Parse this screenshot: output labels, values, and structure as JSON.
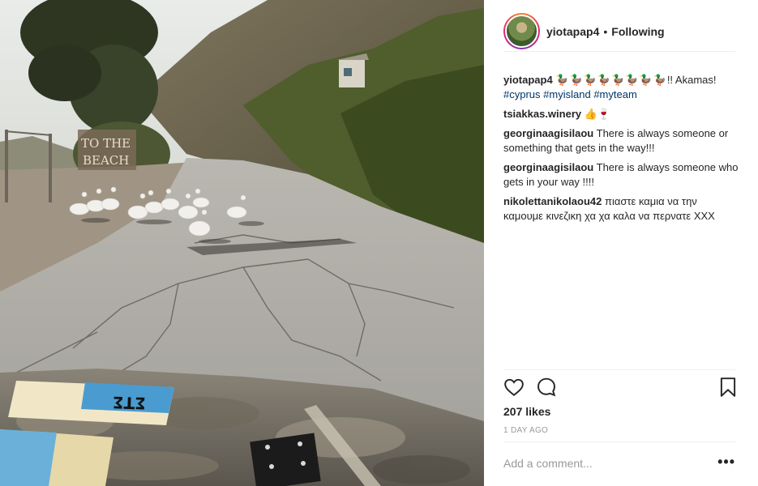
{
  "header": {
    "username": "yiotapap4",
    "separator": "•",
    "follow_status": "Following"
  },
  "caption": {
    "username": "yiotapap4",
    "emoji": "🦆🦆🦆🦆🦆🦆🦆🦆",
    "text": "!! Akamas!",
    "hashtags": [
      "#cyprus",
      "#myisland",
      "#myteam"
    ]
  },
  "comments": [
    {
      "username": "tsiakkas.winery",
      "text": "👍🍷"
    },
    {
      "username": "georginaagisilaou",
      "text": "There is always someone or something that gets in the way!!!"
    },
    {
      "username": "georginaagisilaou",
      "text": "There is always someone who gets in your way !!!!"
    },
    {
      "username": "nikolettanikolaou42",
      "text": "πιαστε καμια να την καμουμε κινεζικη χα χα καλα να περνατε ΧΧΧ"
    }
  ],
  "photo": {
    "sign_text_line1": "TO THE",
    "sign_text_line2": "BEACH",
    "sticker_text": "ΣΤΣ"
  },
  "actions": {
    "icons": [
      "heart-icon",
      "comment-icon",
      "bookmark-icon"
    ]
  },
  "likes": "207 likes",
  "timestamp": "1 DAY AGO",
  "add_comment": {
    "placeholder": "Add a comment...",
    "more": "•••"
  }
}
